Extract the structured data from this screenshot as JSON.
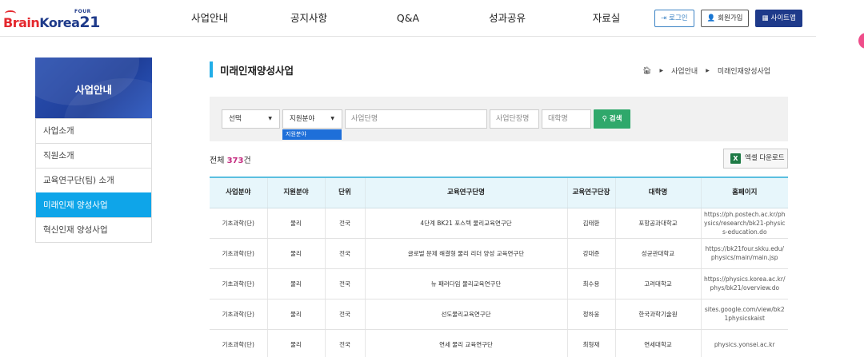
{
  "header": {
    "logo": {
      "four": "FOUR",
      "brain": "Brain",
      "korea": "Korea",
      "num": "21"
    },
    "nav": [
      "사업안내",
      "공지사항",
      "Q&A",
      "성과공유",
      "자료실"
    ],
    "buttons": {
      "login": "로그인",
      "join": "회원가입",
      "sitemap": "사이트맵"
    }
  },
  "sidebar": {
    "title": "사업안내",
    "items": [
      {
        "label": "사업소개",
        "active": false
      },
      {
        "label": "직원소개",
        "active": false
      },
      {
        "label": "교육연구단(팀) 소개",
        "active": false
      },
      {
        "label": "미래인재 양성사업",
        "active": true
      },
      {
        "label": "혁신인재 양성사업",
        "active": false
      }
    ]
  },
  "page": {
    "title": "미래인재양성사업",
    "breadcrumb": [
      "사업안내",
      "미래인재양성사업"
    ]
  },
  "search": {
    "select1": "선택",
    "select2": "지원분야",
    "project_placeholder": "사업단명",
    "leader_placeholder": "사업단장명",
    "univ_placeholder": "대학명",
    "button": "검색",
    "dropdown_option": "지원분야"
  },
  "summary": {
    "prefix": "전체",
    "count": "373",
    "suffix": "건"
  },
  "excel_button": "엑셀 다운로드",
  "table": {
    "headers": [
      "사업분야",
      "지원분야",
      "단위",
      "교육연구단명",
      "교육연구단장",
      "대학명",
      "홈페이지"
    ],
    "rows": [
      [
        "기초과학(단)",
        "물리",
        "전국",
        "4단계 BK21 포스텍 물리교육연구단",
        "김태환",
        "포항공과대학교",
        "https://ph.postech.ac.kr/physics/research/bk21-physics-education.do"
      ],
      [
        "기초과학(단)",
        "물리",
        "전국",
        "글로벌 문제 해결형 물리 리더 양성 교육연구단",
        "강대준",
        "성균관대학교",
        "https://bk21four.skku.edu/physics/main/main.jsp"
      ],
      [
        "기초과학(단)",
        "물리",
        "전국",
        "뉴 패러다임 물리교육연구단",
        "최수용",
        "고려대학교",
        "https://physics.korea.ac.kr/phys/bk21/overview.do"
      ],
      [
        "기초과학(단)",
        "물리",
        "전국",
        "선도물리교육연구단",
        "정하웅",
        "한국과학기술원",
        "sites.google.com/view/bk21physicskaist"
      ],
      [
        "기초과학(단)",
        "물리",
        "전국",
        "연세 물리 교육연구단",
        "최형재",
        "연세대학교",
        "physics.yonsei.ac.kr"
      ]
    ]
  },
  "colors": {
    "brand_navy": "#1e3a8a",
    "accent_sky": "#0ea5e9",
    "search_green": "#2fa86b",
    "count_pink": "#c42b7f"
  }
}
